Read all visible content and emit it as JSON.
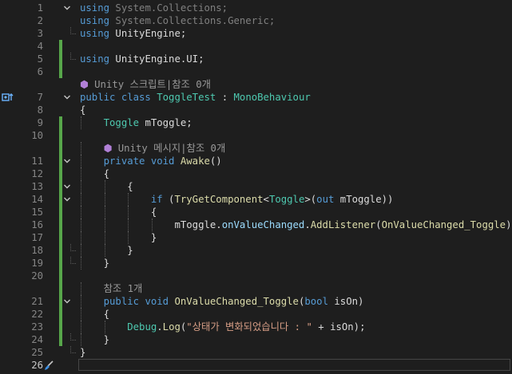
{
  "editor": {
    "lines": [
      {
        "num": "1",
        "fold": "minus",
        "change": false,
        "segments": [
          {
            "t": "using ",
            "c": "kw"
          },
          {
            "t": "System.Collections;",
            "c": "ph"
          }
        ]
      },
      {
        "num": "2",
        "fold": "",
        "change": false,
        "segments": [
          {
            "t": "using ",
            "c": "kw"
          },
          {
            "t": "System.Collections.Generic;",
            "c": "ph"
          }
        ]
      },
      {
        "num": "3",
        "fold": "end",
        "change": false,
        "segments": [
          {
            "t": "using ",
            "c": "kw"
          },
          {
            "t": "UnityEngine;",
            "c": "nm"
          }
        ]
      },
      {
        "num": "4",
        "fold": "",
        "change": true,
        "segments": []
      },
      {
        "num": "5",
        "fold": "end",
        "change": true,
        "segments": [
          {
            "t": "using ",
            "c": "kw"
          },
          {
            "t": "UnityEngine.UI;",
            "c": "nm"
          }
        ]
      },
      {
        "num": "6",
        "fold": "",
        "change": true,
        "segments": []
      },
      {
        "num": "",
        "fold": "",
        "change": false,
        "lens": true,
        "segments": [
          {
            "t": "⬢ ",
            "c": "cube"
          },
          {
            "t": "Unity 스크립트|참조 0개",
            "c": "lens"
          }
        ]
      },
      {
        "num": "7",
        "fold": "minus",
        "change": false,
        "marker": true,
        "segments": [
          {
            "t": "public class ",
            "c": "kw"
          },
          {
            "t": "ToggleTest",
            "c": "ty"
          },
          {
            "t": " : ",
            "c": "nm"
          },
          {
            "t": "MonoBehaviour",
            "c": "ty"
          }
        ]
      },
      {
        "num": "8",
        "fold": "",
        "change": false,
        "segments": [
          {
            "t": "{",
            "c": "nm"
          }
        ]
      },
      {
        "num": "9",
        "fold": "",
        "change": true,
        "segments": [
          {
            "t": "    ",
            "c": "nm"
          },
          {
            "t": "Toggle",
            "c": "ty"
          },
          {
            "t": " mToggle;",
            "c": "nm"
          }
        ]
      },
      {
        "num": "10",
        "fold": "",
        "change": true,
        "segments": []
      },
      {
        "num": "",
        "fold": "",
        "change": true,
        "lens": true,
        "segments": [
          {
            "t": "    ",
            "c": "nm"
          },
          {
            "t": "⬢ ",
            "c": "cube"
          },
          {
            "t": "Unity 메시지|참조 0개",
            "c": "lens"
          }
        ]
      },
      {
        "num": "11",
        "fold": "minus",
        "change": true,
        "segments": [
          {
            "t": "    ",
            "c": "nm"
          },
          {
            "t": "private void ",
            "c": "kw"
          },
          {
            "t": "Awake",
            "c": "fn"
          },
          {
            "t": "()",
            "c": "nm"
          }
        ]
      },
      {
        "num": "12",
        "fold": "",
        "change": true,
        "segments": [
          {
            "t": "    {",
            "c": "nm"
          }
        ]
      },
      {
        "num": "13",
        "fold": "minus",
        "change": true,
        "segments": [
          {
            "t": "        {",
            "c": "nm"
          }
        ]
      },
      {
        "num": "14",
        "fold": "minus",
        "change": true,
        "segments": [
          {
            "t": "            ",
            "c": "nm"
          },
          {
            "t": "if",
            "c": "kw"
          },
          {
            "t": " (",
            "c": "nm"
          },
          {
            "t": "TryGetComponent",
            "c": "fn"
          },
          {
            "t": "<",
            "c": "nm"
          },
          {
            "t": "Toggle",
            "c": "ty"
          },
          {
            "t": ">(",
            "c": "nm"
          },
          {
            "t": "out",
            "c": "kw"
          },
          {
            "t": " mToggle))",
            "c": "nm"
          }
        ]
      },
      {
        "num": "15",
        "fold": "",
        "change": true,
        "segments": [
          {
            "t": "            {",
            "c": "nm"
          }
        ]
      },
      {
        "num": "16",
        "fold": "",
        "change": true,
        "segments": [
          {
            "t": "                mToggle.",
            "c": "nm"
          },
          {
            "t": "onValueChanged",
            "c": "pa"
          },
          {
            "t": ".",
            "c": "nm"
          },
          {
            "t": "AddListener",
            "c": "fn"
          },
          {
            "t": "(",
            "c": "nm"
          },
          {
            "t": "OnValueChanged_Toggle",
            "c": "fn"
          },
          {
            "t": ");",
            "c": "nm"
          }
        ]
      },
      {
        "num": "17",
        "fold": "",
        "change": true,
        "segments": [
          {
            "t": "            }",
            "c": "nm"
          }
        ]
      },
      {
        "num": "18",
        "fold": "end",
        "change": true,
        "segments": [
          {
            "t": "        }",
            "c": "nm"
          }
        ]
      },
      {
        "num": "19",
        "fold": "end",
        "change": true,
        "segments": [
          {
            "t": "    }",
            "c": "nm"
          }
        ]
      },
      {
        "num": "20",
        "fold": "",
        "change": true,
        "segments": []
      },
      {
        "num": "",
        "fold": "",
        "change": true,
        "lens": true,
        "segments": [
          {
            "t": "    참조 1개",
            "c": "lens"
          }
        ]
      },
      {
        "num": "21",
        "fold": "minus",
        "change": true,
        "segments": [
          {
            "t": "    ",
            "c": "nm"
          },
          {
            "t": "public void ",
            "c": "kw"
          },
          {
            "t": "OnValueChanged_Toggle",
            "c": "fn"
          },
          {
            "t": "(",
            "c": "nm"
          },
          {
            "t": "bool",
            "c": "kw"
          },
          {
            "t": " isOn)",
            "c": "nm"
          }
        ]
      },
      {
        "num": "22",
        "fold": "",
        "change": true,
        "segments": [
          {
            "t": "    {",
            "c": "nm"
          }
        ]
      },
      {
        "num": "23",
        "fold": "",
        "change": true,
        "segments": [
          {
            "t": "        ",
            "c": "nm"
          },
          {
            "t": "Debug",
            "c": "ty"
          },
          {
            "t": ".",
            "c": "nm"
          },
          {
            "t": "Log",
            "c": "fn"
          },
          {
            "t": "(",
            "c": "nm"
          },
          {
            "t": "\"상태가 변화되었습니다 : \"",
            "c": "st"
          },
          {
            "t": " + isOn);",
            "c": "nm"
          }
        ]
      },
      {
        "num": "24",
        "fold": "end",
        "change": true,
        "segments": [
          {
            "t": "    }",
            "c": "nm"
          }
        ]
      },
      {
        "num": "25",
        "fold": "end",
        "change": false,
        "segments": [
          {
            "t": "}",
            "c": "nm"
          }
        ]
      },
      {
        "num": "26",
        "fold": "",
        "change": false,
        "current": true,
        "segments": []
      }
    ]
  }
}
